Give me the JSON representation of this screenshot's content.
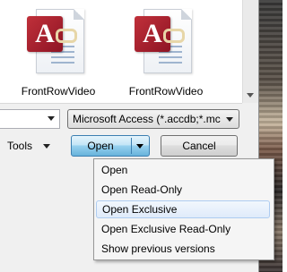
{
  "files": [
    {
      "name": "FrontRowVideo",
      "icon": "access-db-icon"
    },
    {
      "name": "FrontRowVideo",
      "icon": "access-db-icon"
    }
  ],
  "filetype": {
    "selected": "Microsoft Access (*.accdb;*.mc"
  },
  "toolbar": {
    "tools_label": "Tools",
    "open_label": "Open",
    "cancel_label": "Cancel"
  },
  "open_menu": {
    "items": [
      {
        "label": "Open"
      },
      {
        "label": "Open Read-Only"
      },
      {
        "label": "Open Exclusive",
        "highlighted": true
      },
      {
        "label": "Open Exclusive Read-Only"
      },
      {
        "label": "Show previous versions"
      }
    ]
  },
  "colors": {
    "access_red": "#b02a37",
    "highlight_border": "#aeccf1"
  }
}
